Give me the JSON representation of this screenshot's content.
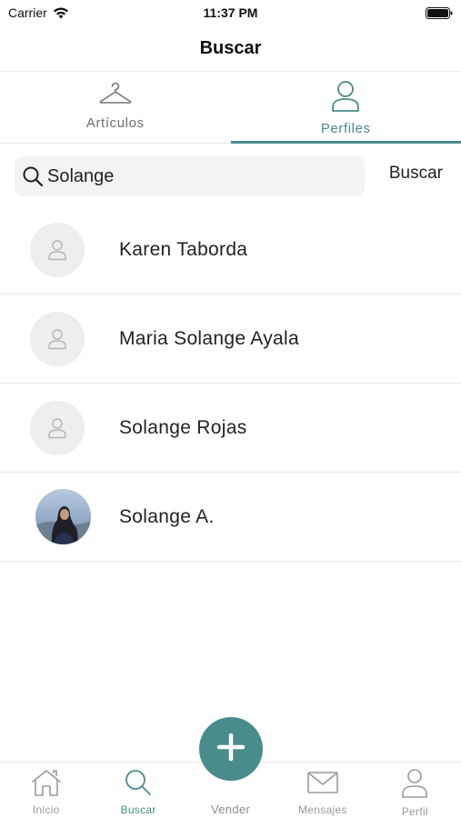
{
  "status_bar": {
    "carrier": "Carrier",
    "time": "11:37 PM"
  },
  "header": {
    "title": "Buscar"
  },
  "segment_tabs": [
    {
      "label": "Artículos",
      "icon": "hanger-icon",
      "active": false
    },
    {
      "label": "Perfiles",
      "icon": "person-icon",
      "active": true
    }
  ],
  "search": {
    "value": "Solange",
    "button_label": "Buscar"
  },
  "results": [
    {
      "name": "Karen Taborda",
      "avatar": "placeholder"
    },
    {
      "name": "Maria Solange Ayala",
      "avatar": "placeholder"
    },
    {
      "name": "Solange Rojas",
      "avatar": "placeholder"
    },
    {
      "name": "Solange A.",
      "avatar": "photo"
    }
  ],
  "tab_bar": [
    {
      "label": "Inicio",
      "icon": "home-icon",
      "active": false
    },
    {
      "label": "Buscar",
      "icon": "search-icon",
      "active": true
    },
    {
      "label": "Vender",
      "icon": "plus-icon",
      "active": false
    },
    {
      "label": "Mensajes",
      "icon": "envelope-icon",
      "active": false
    },
    {
      "label": "Perfil",
      "icon": "person-icon",
      "active": false
    }
  ],
  "colors": {
    "accent": "#4a8c8c",
    "inactive": "#9a9a9a",
    "search_bg": "#f2f3f5",
    "avatar_bg": "#eeeeee"
  }
}
